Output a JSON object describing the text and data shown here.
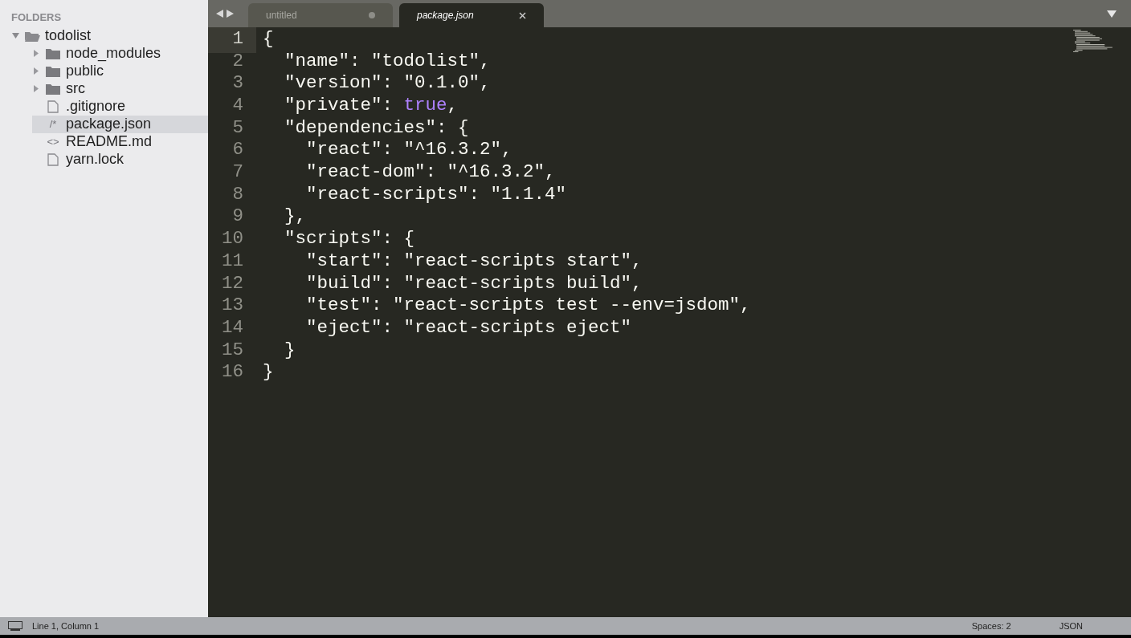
{
  "sidebar": {
    "heading": "FOLDERS",
    "tree": [
      {
        "name": "todolist",
        "kind": "folder",
        "expanded": true,
        "selected": false,
        "children": [
          {
            "name": "node_modules",
            "kind": "folder",
            "expanded": false,
            "selected": false
          },
          {
            "name": "public",
            "kind": "folder",
            "expanded": false,
            "selected": false
          },
          {
            "name": "src",
            "kind": "folder",
            "expanded": false,
            "selected": false
          },
          {
            "name": ".gitignore",
            "kind": "file",
            "selected": false
          },
          {
            "name": "package.json",
            "kind": "glyph",
            "icon_text": "/*",
            "selected": true
          },
          {
            "name": "README.md",
            "kind": "glyph",
            "icon_text": "<>",
            "selected": false
          },
          {
            "name": "yarn.lock",
            "kind": "file",
            "selected": false
          }
        ]
      }
    ]
  },
  "tabs": [
    {
      "label": "untitled",
      "selected": false,
      "modified": true
    },
    {
      "label": "package.json",
      "selected": true,
      "modified": false
    }
  ],
  "editor": {
    "lines": [
      {
        "number": "1",
        "current": true,
        "tokens": [
          {
            "kind": "plain",
            "text": "{"
          }
        ]
      },
      {
        "number": "2",
        "current": false,
        "tokens": [
          {
            "kind": "plain",
            "text": "  \"name\": \"todolist\","
          }
        ]
      },
      {
        "number": "3",
        "current": false,
        "tokens": [
          {
            "kind": "plain",
            "text": "  \"version\": \"0.1.0\","
          }
        ]
      },
      {
        "number": "4",
        "current": false,
        "tokens": [
          {
            "kind": "plain",
            "text": "  \"private\": "
          },
          {
            "kind": "constant",
            "text": "true"
          },
          {
            "kind": "plain",
            "text": ","
          }
        ]
      },
      {
        "number": "5",
        "current": false,
        "tokens": [
          {
            "kind": "plain",
            "text": "  \"dependencies\": {"
          }
        ]
      },
      {
        "number": "6",
        "current": false,
        "tokens": [
          {
            "kind": "plain",
            "text": "    \"react\": \"^16.3.2\","
          }
        ]
      },
      {
        "number": "7",
        "current": false,
        "tokens": [
          {
            "kind": "plain",
            "text": "    \"react-dom\": \"^16.3.2\","
          }
        ]
      },
      {
        "number": "8",
        "current": false,
        "tokens": [
          {
            "kind": "plain",
            "text": "    \"react-scripts\": \"1.1.4\""
          }
        ]
      },
      {
        "number": "9",
        "current": false,
        "tokens": [
          {
            "kind": "plain",
            "text": "  },"
          }
        ]
      },
      {
        "number": "10",
        "current": false,
        "tokens": [
          {
            "kind": "plain",
            "text": "  \"scripts\": {"
          }
        ]
      },
      {
        "number": "11",
        "current": false,
        "tokens": [
          {
            "kind": "plain",
            "text": "    \"start\": \"react-scripts start\","
          }
        ]
      },
      {
        "number": "12",
        "current": false,
        "tokens": [
          {
            "kind": "plain",
            "text": "    \"build\": \"react-scripts build\","
          }
        ]
      },
      {
        "number": "13",
        "current": false,
        "tokens": [
          {
            "kind": "plain",
            "text": "    \"test\": \"react-scripts test --env=jsdom\","
          }
        ]
      },
      {
        "number": "14",
        "current": false,
        "tokens": [
          {
            "kind": "plain",
            "text": "    \"eject\": \"react-scripts eject\""
          }
        ]
      },
      {
        "number": "15",
        "current": false,
        "tokens": [
          {
            "kind": "plain",
            "text": "  }"
          }
        ]
      },
      {
        "number": "16",
        "current": false,
        "tokens": [
          {
            "kind": "plain",
            "text": "}"
          }
        ]
      }
    ]
  },
  "status_bar": {
    "position": "Line 1, Column 1",
    "indentation": "Spaces: 2",
    "syntax": "JSON"
  }
}
